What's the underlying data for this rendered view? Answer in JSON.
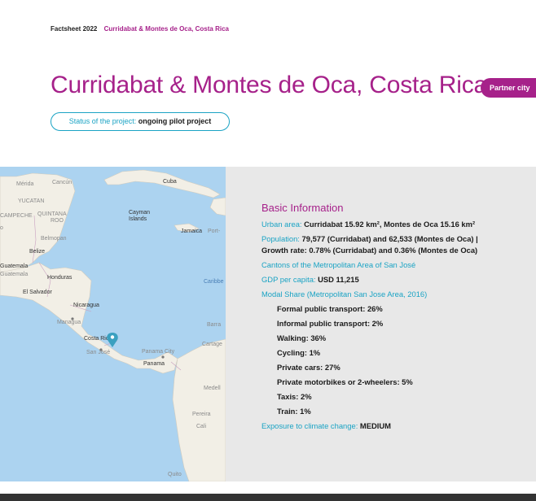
{
  "header": {
    "factsheet": "Factsheet 2022",
    "location": "Curridabat & Montes de Oca, Costa Rica"
  },
  "title": "Curridabat & Montes de Oca, Costa Rica",
  "badge": "Partner city",
  "status": {
    "label": "Status of the project:",
    "value": "ongoing pilot project"
  },
  "map": {
    "labels": [
      "Mérida",
      "Cancún",
      "YUCATAN",
      "CAMPECHE",
      "QUINTANA",
      "ROO",
      "Belmopan",
      "Belize",
      "Cuba",
      "Cayman",
      "Islands",
      "Jamaica",
      "Port-",
      "Guatemala",
      "Guatemala",
      "Honduras",
      "El Salvador",
      "Caribbe",
      "Nicaragua",
      "Managua",
      "Costa Rica",
      "San José",
      "Barra",
      "Cartage",
      "Panama City",
      "Panama",
      "Medell",
      "Pereira",
      "Cali",
      "Quito",
      "o"
    ]
  },
  "info": {
    "heading": "Basic Information",
    "urban_area": {
      "label": "Urban area:",
      "value": "Curridabat 15.92 km², Montes de Oca 15.16 km²"
    },
    "population": {
      "label": "Population:",
      "value": "79,577 (Curridabat) and 62,533 (Montes de Oca) | Growth rate: 0.78% (Curridabat) and 0.36% (Montes de Oca)"
    },
    "cantons": "Cantons of the Metropolitan Area of San José",
    "gdp": {
      "label": "GDP per capita:",
      "value": "USD 11,215"
    },
    "modal_share_label": "Modal Share (Metropolitan San Jose Area, 2016)",
    "modal_items": [
      "Formal public transport: 26%",
      "Informal public transport: 2%",
      "Walking: 36%",
      "Cycling: 1%",
      "Private cars: 27%",
      "Private motorbikes or 2-wheelers: 5%",
      "Taxis: 2%",
      "Train: 1%"
    ],
    "exposure": {
      "label": "Exposure to climate change:",
      "value": "MEDIUM"
    }
  },
  "colors": {
    "accent": "#a6218a",
    "cyan": "#1aa3c4",
    "panel": "#e8e8e8",
    "sea": "#acd3f0",
    "land": "#f2efe6"
  }
}
